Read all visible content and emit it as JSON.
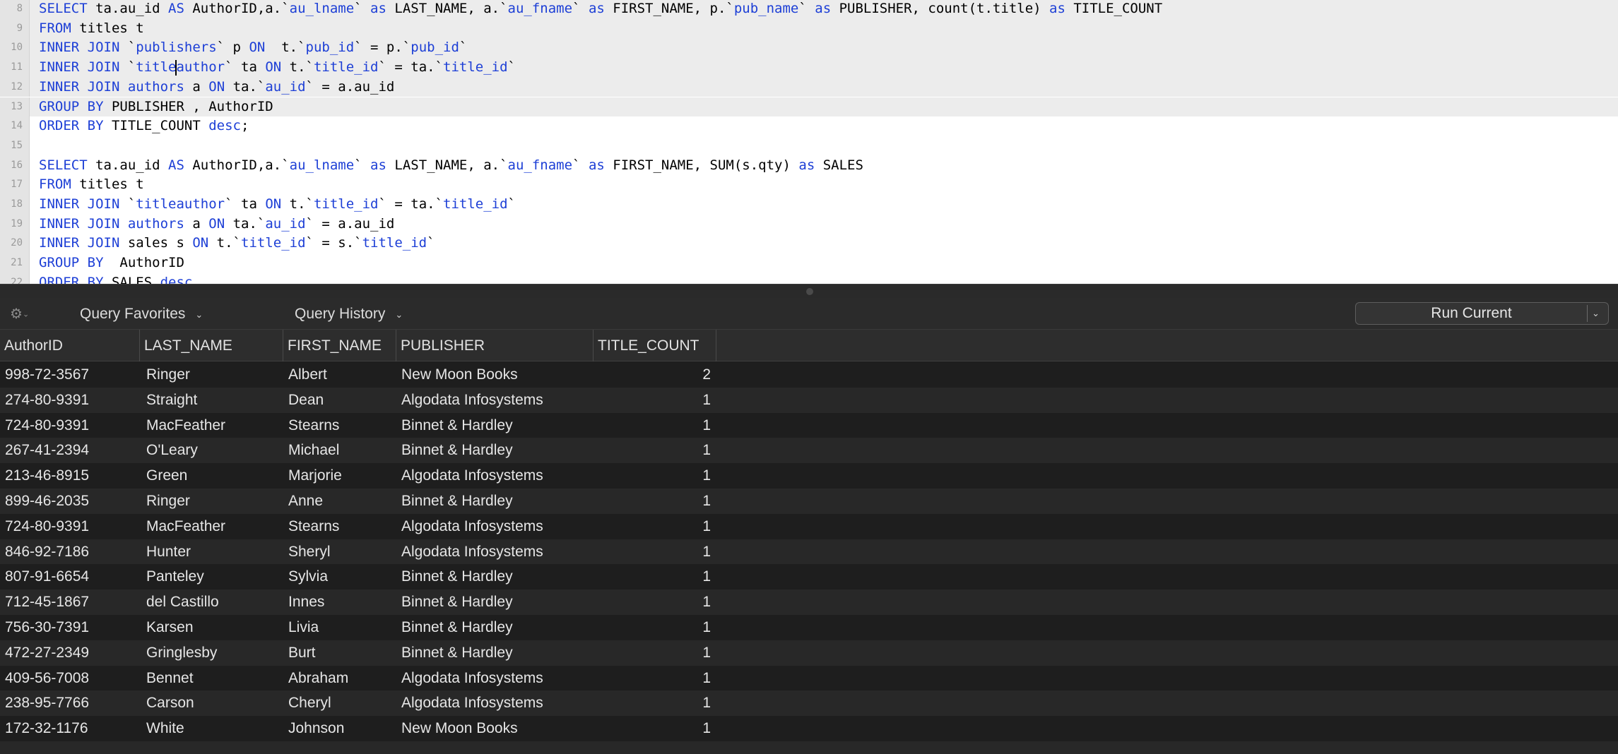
{
  "editor": {
    "lines": [
      {
        "num": "8",
        "highlight": true,
        "tokens": [
          [
            "kw",
            "SELECT"
          ],
          [
            "t",
            " ta.au_id "
          ],
          [
            "kw",
            "AS"
          ],
          [
            "t",
            " AuthorID,a.`"
          ],
          [
            "kw",
            "au_lname"
          ],
          [
            "t",
            "` "
          ],
          [
            "kw",
            "as"
          ],
          [
            "t",
            " LAST_NAME, a.`"
          ],
          [
            "kw",
            "au_fname"
          ],
          [
            "t",
            "` "
          ],
          [
            "kw",
            "as"
          ],
          [
            "t",
            " FIRST_NAME, p.`"
          ],
          [
            "kw",
            "pub_name"
          ],
          [
            "t",
            "` "
          ],
          [
            "kw",
            "as"
          ],
          [
            "t",
            " PUBLISHER, count(t.title) "
          ],
          [
            "kw",
            "as"
          ],
          [
            "t",
            " TITLE_COUNT"
          ]
        ]
      },
      {
        "num": "9",
        "highlight": true,
        "tokens": [
          [
            "kw",
            "FROM"
          ],
          [
            "t",
            " titles t"
          ]
        ]
      },
      {
        "num": "10",
        "highlight": true,
        "tokens": [
          [
            "kw",
            "INNER JOIN"
          ],
          [
            "t",
            " `"
          ],
          [
            "kw",
            "publishers"
          ],
          [
            "t",
            "` p "
          ],
          [
            "kw",
            "ON"
          ],
          [
            "t",
            "  t.`"
          ],
          [
            "kw",
            "pub_id"
          ],
          [
            "t",
            "` = p.`"
          ],
          [
            "kw",
            "pub_id"
          ],
          [
            "t",
            "`"
          ]
        ]
      },
      {
        "num": "11",
        "highlight": true,
        "tokens": [
          [
            "kw",
            "INNER JOIN"
          ],
          [
            "t",
            " `"
          ],
          [
            "kw",
            "title"
          ],
          [
            "caret",
            ""
          ],
          [
            "kw",
            "author"
          ],
          [
            "t",
            "` ta "
          ],
          [
            "kw",
            "ON"
          ],
          [
            "t",
            " t.`"
          ],
          [
            "kw",
            "title_id"
          ],
          [
            "t",
            "` = ta.`"
          ],
          [
            "kw",
            "title_id"
          ],
          [
            "t",
            "`"
          ]
        ]
      },
      {
        "num": "12",
        "highlight": true,
        "tokens": [
          [
            "kw",
            "INNER JOIN"
          ],
          [
            "t",
            " "
          ],
          [
            "kw",
            "authors"
          ],
          [
            "t",
            " a "
          ],
          [
            "kw",
            "ON"
          ],
          [
            "t",
            " ta.`"
          ],
          [
            "kw",
            "au_id"
          ],
          [
            "t",
            "` = a.au_id"
          ]
        ]
      },
      {
        "num": "13",
        "highlight": true,
        "tokens": [
          [
            "kw",
            "GROUP BY"
          ],
          [
            "t",
            " PUBLISHER , AuthorID"
          ]
        ]
      },
      {
        "num": "14",
        "highlight": false,
        "tokens": [
          [
            "kw",
            "ORDER BY"
          ],
          [
            "t",
            " TITLE_COUNT "
          ],
          [
            "kw",
            "desc"
          ],
          [
            "t",
            ";"
          ]
        ]
      },
      {
        "num": "15",
        "highlight": false,
        "tokens": []
      },
      {
        "num": "16",
        "highlight": false,
        "tokens": [
          [
            "kw",
            "SELECT"
          ],
          [
            "t",
            " ta.au_id "
          ],
          [
            "kw",
            "AS"
          ],
          [
            "t",
            " AuthorID,a.`"
          ],
          [
            "kw",
            "au_lname"
          ],
          [
            "t",
            "` "
          ],
          [
            "kw",
            "as"
          ],
          [
            "t",
            " LAST_NAME, a.`"
          ],
          [
            "kw",
            "au_fname"
          ],
          [
            "t",
            "` "
          ],
          [
            "kw",
            "as"
          ],
          [
            "t",
            " FIRST_NAME, SUM(s.qty) "
          ],
          [
            "kw",
            "as"
          ],
          [
            "t",
            " SALES"
          ]
        ]
      },
      {
        "num": "17",
        "highlight": false,
        "tokens": [
          [
            "kw",
            "FROM"
          ],
          [
            "t",
            " titles t"
          ]
        ]
      },
      {
        "num": "18",
        "highlight": false,
        "tokens": [
          [
            "kw",
            "INNER JOIN"
          ],
          [
            "t",
            " `"
          ],
          [
            "kw",
            "titleauthor"
          ],
          [
            "t",
            "` ta "
          ],
          [
            "kw",
            "ON"
          ],
          [
            "t",
            " t.`"
          ],
          [
            "kw",
            "title_id"
          ],
          [
            "t",
            "` = ta.`"
          ],
          [
            "kw",
            "title_id"
          ],
          [
            "t",
            "`"
          ]
        ]
      },
      {
        "num": "19",
        "highlight": false,
        "tokens": [
          [
            "kw",
            "INNER JOIN"
          ],
          [
            "t",
            " "
          ],
          [
            "kw",
            "authors"
          ],
          [
            "t",
            " a "
          ],
          [
            "kw",
            "ON"
          ],
          [
            "t",
            " ta.`"
          ],
          [
            "kw",
            "au_id"
          ],
          [
            "t",
            "` = a.au_id"
          ]
        ]
      },
      {
        "num": "20",
        "highlight": false,
        "tokens": [
          [
            "kw",
            "INNER JOIN"
          ],
          [
            "t",
            " sales s "
          ],
          [
            "kw",
            "ON"
          ],
          [
            "t",
            " t.`"
          ],
          [
            "kw",
            "title_id"
          ],
          [
            "t",
            "` = s.`"
          ],
          [
            "kw",
            "title_id"
          ],
          [
            "t",
            "`"
          ]
        ]
      },
      {
        "num": "21",
        "highlight": false,
        "tokens": [
          [
            "kw",
            "GROUP BY"
          ],
          [
            "t",
            "  AuthorID"
          ]
        ]
      },
      {
        "num": "22",
        "highlight": false,
        "tokens": [
          [
            "kw",
            "ORDER BY"
          ],
          [
            "t",
            " SALES "
          ],
          [
            "kw",
            "desc"
          ]
        ]
      }
    ]
  },
  "toolbar": {
    "gear_icon": "gear-icon",
    "favorites_label": "Query Favorites",
    "history_label": "Query History",
    "run_label": "Run Current"
  },
  "results": {
    "columns": [
      "AuthorID",
      "LAST_NAME",
      "FIRST_NAME",
      "PUBLISHER",
      "TITLE_COUNT"
    ],
    "rows": [
      [
        "998-72-3567",
        "Ringer",
        "Albert",
        "New Moon Books",
        "2"
      ],
      [
        "274-80-9391",
        "Straight",
        "Dean",
        "Algodata Infosystems",
        "1"
      ],
      [
        "724-80-9391",
        "MacFeather",
        "Stearns",
        "Binnet & Hardley",
        "1"
      ],
      [
        "267-41-2394",
        "O'Leary",
        "Michael",
        "Binnet & Hardley",
        "1"
      ],
      [
        "213-46-8915",
        "Green",
        "Marjorie",
        "Algodata Infosystems",
        "1"
      ],
      [
        "899-46-2035",
        "Ringer",
        "Anne",
        "Binnet & Hardley",
        "1"
      ],
      [
        "724-80-9391",
        "MacFeather",
        "Stearns",
        "Algodata Infosystems",
        "1"
      ],
      [
        "846-92-7186",
        "Hunter",
        "Sheryl",
        "Algodata Infosystems",
        "1"
      ],
      [
        "807-91-6654",
        "Panteley",
        "Sylvia",
        "Binnet & Hardley",
        "1"
      ],
      [
        "712-45-1867",
        "del Castillo",
        "Innes",
        "Binnet & Hardley",
        "1"
      ],
      [
        "756-30-7391",
        "Karsen",
        "Livia",
        "Binnet & Hardley",
        "1"
      ],
      [
        "472-27-2349",
        "Gringlesby",
        "Burt",
        "Binnet & Hardley",
        "1"
      ],
      [
        "409-56-7008",
        "Bennet",
        "Abraham",
        "Algodata Infosystems",
        "1"
      ],
      [
        "238-95-7766",
        "Carson",
        "Cheryl",
        "Algodata Infosystems",
        "1"
      ],
      [
        "172-32-1176",
        "White",
        "Johnson",
        "New Moon Books",
        "1"
      ]
    ]
  }
}
